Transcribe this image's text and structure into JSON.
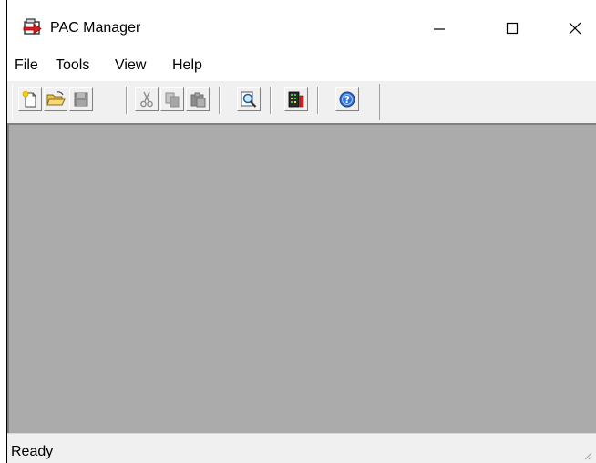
{
  "window": {
    "title": "PAC Manager"
  },
  "menu": {
    "items": [
      {
        "label": "File"
      },
      {
        "label": "Tools"
      },
      {
        "label": "View"
      },
      {
        "label": "Help"
      }
    ]
  },
  "toolbar": {
    "buttons": [
      {
        "name": "new-icon",
        "enabled": true
      },
      {
        "name": "open-folder-icon",
        "enabled": true
      },
      {
        "name": "save-icon",
        "enabled": false
      },
      {
        "name": "cut-icon",
        "enabled": false
      },
      {
        "name": "copy-icon",
        "enabled": false
      },
      {
        "name": "paste-icon",
        "enabled": false
      },
      {
        "name": "find-icon",
        "enabled": true
      },
      {
        "name": "settings-icon",
        "enabled": true
      },
      {
        "name": "help-icon",
        "enabled": true
      }
    ]
  },
  "status": {
    "text": "Ready"
  },
  "colors": {
    "client_bg": "#ababab",
    "chrome": "#f0f0f0",
    "help_blue": "#2f6fd6",
    "accent_red": "#d42020"
  }
}
